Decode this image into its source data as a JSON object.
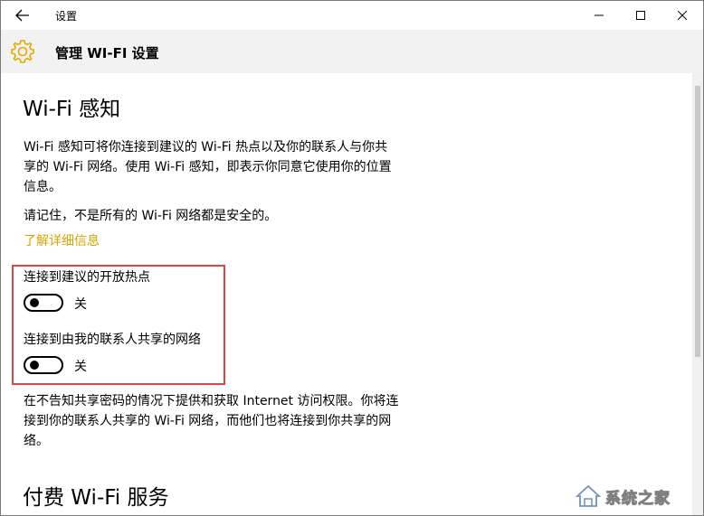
{
  "window": {
    "title": "设置"
  },
  "header": {
    "title": "管理 WI-FI 设置"
  },
  "wifi_sense": {
    "heading": "Wi-Fi 感知",
    "description": [
      "Wi-Fi 感知可将你连接到建议的 Wi-Fi 热点以及你的联系人与你共",
      "享的 Wi-Fi 网络。使用 Wi-Fi 感知，即表示你同意它使用你的位置",
      "信息。"
    ],
    "warning": "请记住，不是所有的 Wi-Fi 网络都是安全的。",
    "learn_more": "了解详细信息",
    "toggles": [
      {
        "label": "连接到建议的开放热点",
        "state": "关"
      },
      {
        "label": "连接到由我的联系人共享的网络",
        "state": "关"
      }
    ],
    "footer_text": [
      "在不告知共享密码的情况下提供和获取 Internet 访问权限。你将连",
      "接到你的联系人共享的 Wi-Fi 网络，而他们也将连接到你共享的网",
      "络。"
    ]
  },
  "paid_wifi": {
    "heading": "付费 Wi-Fi 服务"
  },
  "watermark": {
    "text": "系统之家"
  },
  "colors": {
    "accent": "#d4a500",
    "highlight_border": "#e04545",
    "header_bg": "#f2f2f2"
  }
}
